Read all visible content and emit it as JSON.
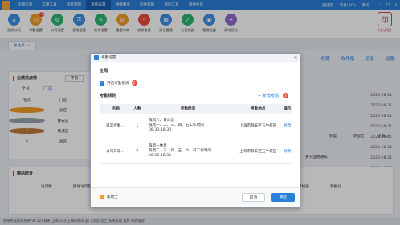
{
  "topnav": [
    "房源房源",
    "实用工具",
    "统客管理",
    "系统设置",
    "增值服务",
    "软件帮助",
    "我的工具",
    "我要投诉"
  ],
  "user": {
    "name": "超陆历",
    "msg": "消息(0/2)",
    "mine": "我的"
  },
  "toolbar": [
    {
      "label": "组织公司",
      "color": "#3b8fe5",
      "icon": "⌂",
      "badge": ""
    },
    {
      "label": "考勤设置",
      "color": "#f29b26",
      "icon": "◷",
      "badge": "1"
    },
    {
      "label": "公司设置",
      "color": "#2bb673",
      "icon": "⚙",
      "badge": ""
    },
    {
      "label": "权限设置",
      "color": "#3b8fe5",
      "icon": "⚿",
      "badge": ""
    },
    {
      "label": "软件设置",
      "color": "#2bb673",
      "icon": "✎",
      "badge": ""
    },
    {
      "label": "楼盘字典",
      "color": "#f29b26",
      "icon": "▤",
      "badge": ""
    },
    {
      "label": "房源查重",
      "color": "#e94b3c",
      "icon": "⌕",
      "badge": ""
    },
    {
      "label": "部位管理",
      "color": "#3b8fe5",
      "icon": "▦",
      "badge": ""
    },
    {
      "label": "认证机器",
      "color": "#2bb673",
      "icon": "✓",
      "badge": ""
    },
    {
      "label": "管理机器",
      "color": "#3b8fe5",
      "icon": "▣",
      "badge": ""
    },
    {
      "label": "离线授权",
      "color": "#8d6cd1",
      "icon": "✦",
      "badge": ""
    }
  ],
  "stamp": {
    "label": "[未认证]"
  },
  "tab": {
    "label": "总站点"
  },
  "actions": [
    "收藏",
    "收件箱",
    "消息",
    "设置"
  ],
  "left": {
    "title": "业绩龙虎榜",
    "filter": "不限",
    "tabs": [
      "个人",
      "门店"
    ],
    "cols": [
      "名次",
      "门店",
      "总计"
    ],
    "rows": [
      {
        "rank": "1",
        "store": "总店",
        "total": "",
        "color": "#f29b26"
      },
      {
        "rank": "2",
        "store": "静安店",
        "total": "",
        "color": "#9aa3b0"
      },
      {
        "rank": "3",
        "store": "杨浦店",
        "total": "",
        "color": "#c07a3a"
      },
      {
        "rank": "4",
        "store": "总店",
        "total": "",
        "color": ""
      }
    ]
  },
  "dates": [
    "2020-08-21",
    "2020-08-21",
    "2020-08-21",
    "2020-08-21",
    "2020-08-21",
    "2020-08-21",
    "2020-08-21",
    "2020-08-21"
  ],
  "rcols": {
    "a": "制度",
    "b": "明星汇",
    "c": "更多 >",
    "d": "通知",
    "e": "关于业绩通知"
  },
  "bottom": {
    "title": "微站统计",
    "cols": [
      "访问数",
      "微站访问量",
      "房源访问",
      "分享次数",
      "新增房源",
      "求购客户",
      "新客源",
      "新楼盘",
      "新机器",
      "新报价"
    ]
  },
  "status": "宽带房屋管理系统(V6.52)   城市:上海   公司:上海好房网   部门:总店   员工:系统管理   角色:系统管理",
  "modal": {
    "title": "考勤设置",
    "section1": "全局",
    "check": "开启考勤系统",
    "badge1": "2",
    "section2": "考勤规则",
    "add": "+ 新增考勤",
    "badge2": "4",
    "cols": [
      "名称",
      "人数",
      "考勤时间",
      "考勤地点",
      "操作"
    ],
    "rows": [
      {
        "name": "日常考勤...",
        "count": "1",
        "line1": "每周六、日休息",
        "line2": "每周一、二、三、四、五工作时间",
        "line3": "08:30-18:30",
        "place": "上海市静安区五牛校园",
        "op": "修改"
      },
      {
        "name": "公司日常...",
        "count": "6",
        "line1": "每周一休息",
        "line2": "每周二、三、四、五、六、日工作时间",
        "line3": "08:30-18:30",
        "place": "上海市静安区五牛校园",
        "op": "修改"
      }
    ],
    "help": "帮助士",
    "cancel": "取消",
    "ok": "确定",
    "close": "×"
  }
}
